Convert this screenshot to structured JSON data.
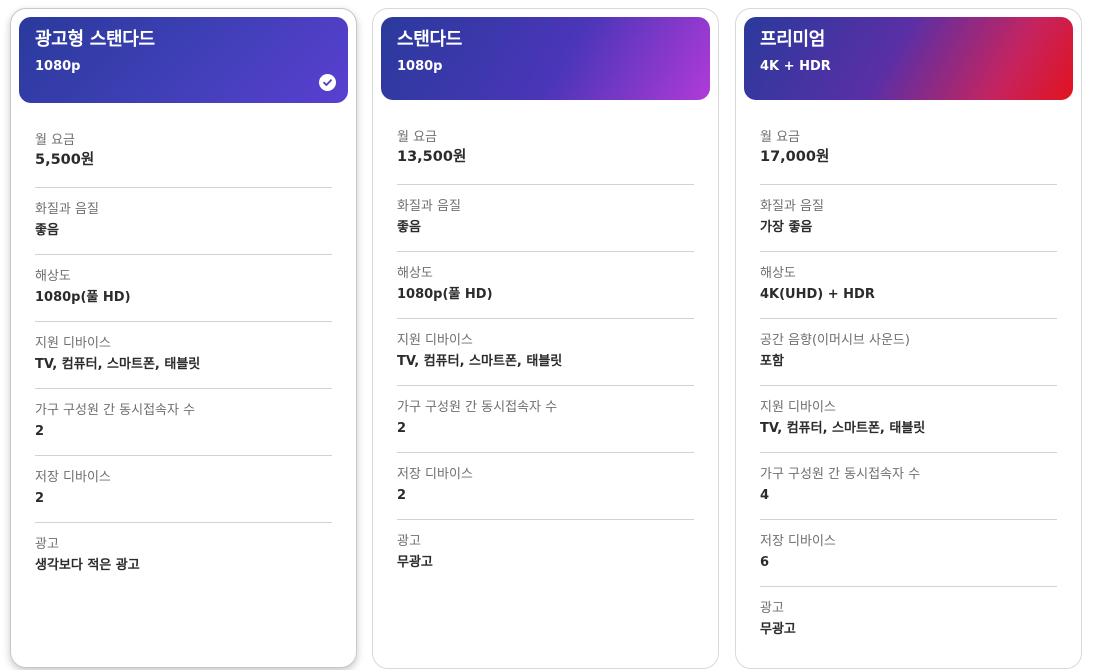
{
  "plans": [
    {
      "name": "광고형 스탠다드",
      "resolution_badge": "1080p",
      "selected": true,
      "features": [
        {
          "label": "월 요금",
          "value": "5,500원"
        },
        {
          "label": "화질과 음질",
          "value": "좋음"
        },
        {
          "label": "해상도",
          "value": "1080p(풀 HD)"
        },
        {
          "label": "지원 디바이스",
          "value": "TV, 컴퓨터, 스마트폰, 태블릿"
        },
        {
          "label": "가구 구성원 간 동시접속자 수",
          "value": "2"
        },
        {
          "label": "저장 디바이스",
          "value": "2"
        },
        {
          "label": "광고",
          "value": "생각보다 적은 광고"
        }
      ]
    },
    {
      "name": "스탠다드",
      "resolution_badge": "1080p",
      "selected": false,
      "features": [
        {
          "label": "월 요금",
          "value": "13,500원"
        },
        {
          "label": "화질과 음질",
          "value": "좋음"
        },
        {
          "label": "해상도",
          "value": "1080p(풀 HD)"
        },
        {
          "label": "지원 디바이스",
          "value": "TV, 컴퓨터, 스마트폰, 태블릿"
        },
        {
          "label": "가구 구성원 간 동시접속자 수",
          "value": "2"
        },
        {
          "label": "저장 디바이스",
          "value": "2"
        },
        {
          "label": "광고",
          "value": "무광고"
        }
      ]
    },
    {
      "name": "프리미엄",
      "resolution_badge": "4K + HDR",
      "selected": false,
      "features": [
        {
          "label": "월 요금",
          "value": "17,000원"
        },
        {
          "label": "화질과 음질",
          "value": "가장 좋음"
        },
        {
          "label": "해상도",
          "value": "4K(UHD) + HDR"
        },
        {
          "label": "공간 음향(이머시브 사운드)",
          "value": "포함"
        },
        {
          "label": "지원 디바이스",
          "value": "TV, 컴퓨터, 스마트폰, 태블릿"
        },
        {
          "label": "가구 구성원 간 동시접속자 수",
          "value": "4"
        },
        {
          "label": "저장 디바이스",
          "value": "6"
        },
        {
          "label": "광고",
          "value": "무광고"
        }
      ]
    }
  ],
  "selected_icon": "check-circle-icon"
}
